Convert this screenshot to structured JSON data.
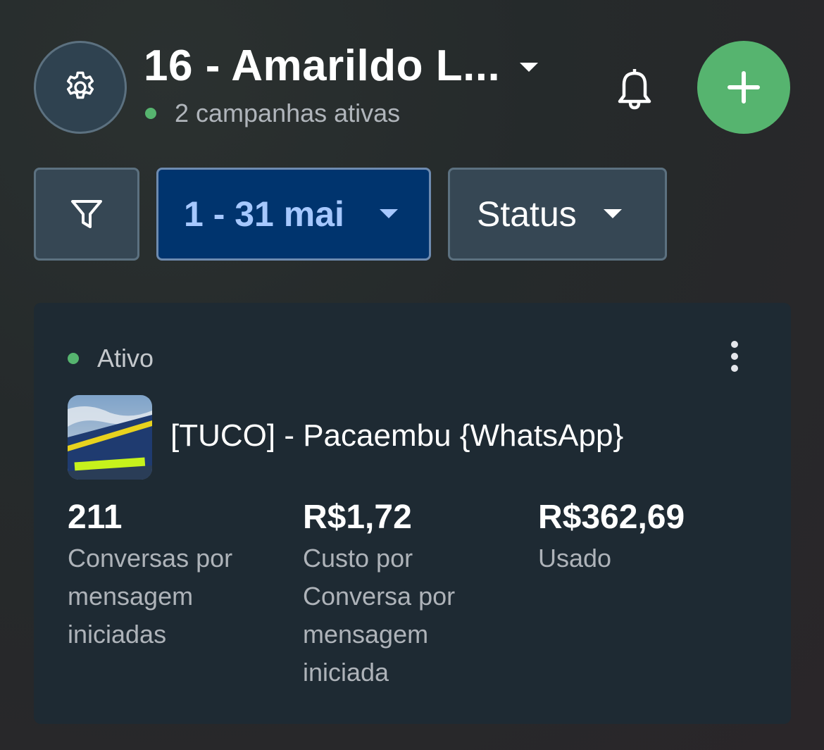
{
  "header": {
    "title": "16 - Amarildo L...",
    "subtitle": "2 campanhas ativas",
    "status_color": "#56b46f",
    "add_color": "#56b46f"
  },
  "filters": {
    "date_range": "1 - 31 mai",
    "status_label": "Status"
  },
  "campaign": {
    "status": "Ativo",
    "name": "[TUCO] - Pacaembu {WhatsApp}",
    "metrics": [
      {
        "value": "211",
        "label": "Conversas por mensagem iniciadas"
      },
      {
        "value": "R$1,72",
        "label": "Custo por Conversa por mensagem iniciada"
      },
      {
        "value": "R$362,69",
        "label": "Usado"
      }
    ]
  },
  "icons": [
    "gear-icon",
    "chevron-down-icon",
    "bell-icon",
    "plus-icon",
    "filter-icon",
    "more-vertical-icon"
  ]
}
